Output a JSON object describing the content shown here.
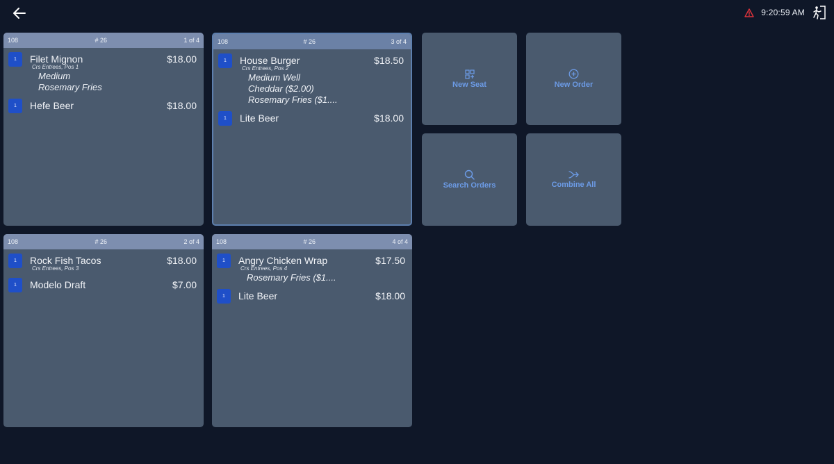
{
  "header": {
    "back_icon": "arrow-left-icon",
    "warning_icon": "warning-triangle-icon",
    "time": "9:20:59 AM",
    "exit_icon": "exit-door-icon"
  },
  "orders": [
    {
      "table": "108",
      "check": "# 26",
      "page": "1 of 4",
      "items": [
        {
          "seat": "1",
          "name": "Filet Mignon",
          "price": "$18.00",
          "sub": "Crs Entrees, Pos 1",
          "mods": [
            "Medium",
            "Rosemary Fries"
          ]
        },
        {
          "seat": "1",
          "name": "Hefe Beer",
          "price": "$18.00"
        }
      ]
    },
    {
      "table": "108",
      "check": "# 26",
      "page": "3 of 4",
      "items": [
        {
          "seat": "1",
          "name": "House Burger",
          "price": "$18.50",
          "sub": "Crs Entrees, Pos 2",
          "mods": [
            "Medium Well",
            "Cheddar ($2.00)",
            "Rosemary Fries ($1...."
          ]
        },
        {
          "seat": "1",
          "name": "Lite Beer",
          "price": "$18.00"
        }
      ]
    },
    {
      "table": "108",
      "check": "# 26",
      "page": "2 of 4",
      "items": [
        {
          "seat": "1",
          "name": "Rock Fish Tacos",
          "price": "$18.00",
          "sub": "Crs Entrees, Pos 3"
        },
        {
          "seat": "1",
          "name": "Modelo Draft",
          "price": "$7.00"
        }
      ]
    },
    {
      "table": "108",
      "check": "# 26",
      "page": "4 of 4",
      "items": [
        {
          "seat": "1",
          "name": "Angry Chicken Wrap",
          "price": "$17.50",
          "sub": "Crs Entrees, Pos 4",
          "mods": [
            "Rosemary Fries ($1...."
          ]
        },
        {
          "seat": "1",
          "name": "Lite Beer",
          "price": "$18.00"
        }
      ]
    }
  ],
  "actions": {
    "new_seat": {
      "label": "New Seat",
      "icon": "grid-plus-icon"
    },
    "new_order": {
      "label": "New Order",
      "icon": "circle-plus-icon"
    },
    "search_orders": {
      "label": "Search Orders",
      "icon": "search-icon"
    },
    "combine_all": {
      "label": "Combine All",
      "icon": "merge-arrow-icon"
    }
  },
  "colors": {
    "background": "#0f1728",
    "card": "#4a5a6e",
    "card_header": "#7d8eaf",
    "seat_badge": "#1f4fc8",
    "accent": "#6c9be6",
    "warning": "#e0343c"
  }
}
